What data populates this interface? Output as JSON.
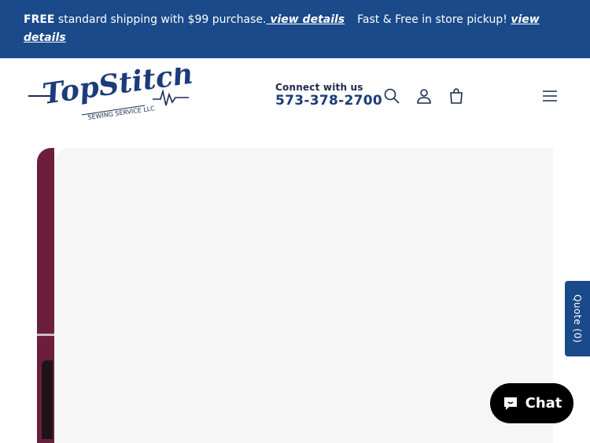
{
  "announcement": {
    "free_label": "FREE",
    "shipping_text": " standard shipping with $99 purchase.",
    "view_details_1": " view details",
    "pickup_text": "Fast & Free in store pickup!",
    "view_details_2": "view details"
  },
  "header": {
    "logo_text": "TopStitch",
    "logo_sub": "SEWING SERVICE LLC",
    "connect_label": "Connect with us",
    "phone": "573-378-2700",
    "icons": [
      "search-icon",
      "account-icon",
      "cart-icon",
      "menu-icon"
    ]
  },
  "quote_tab": {
    "label": "Quote (0)"
  },
  "chat": {
    "label": "Chat",
    "icon": "chat-bubble-icon"
  },
  "colors": {
    "announcement_bg": "#1a4a8a",
    "hero_accent": "#6b1f3d",
    "chat_bg": "#000000",
    "brand_text": "#1b2a4e"
  }
}
